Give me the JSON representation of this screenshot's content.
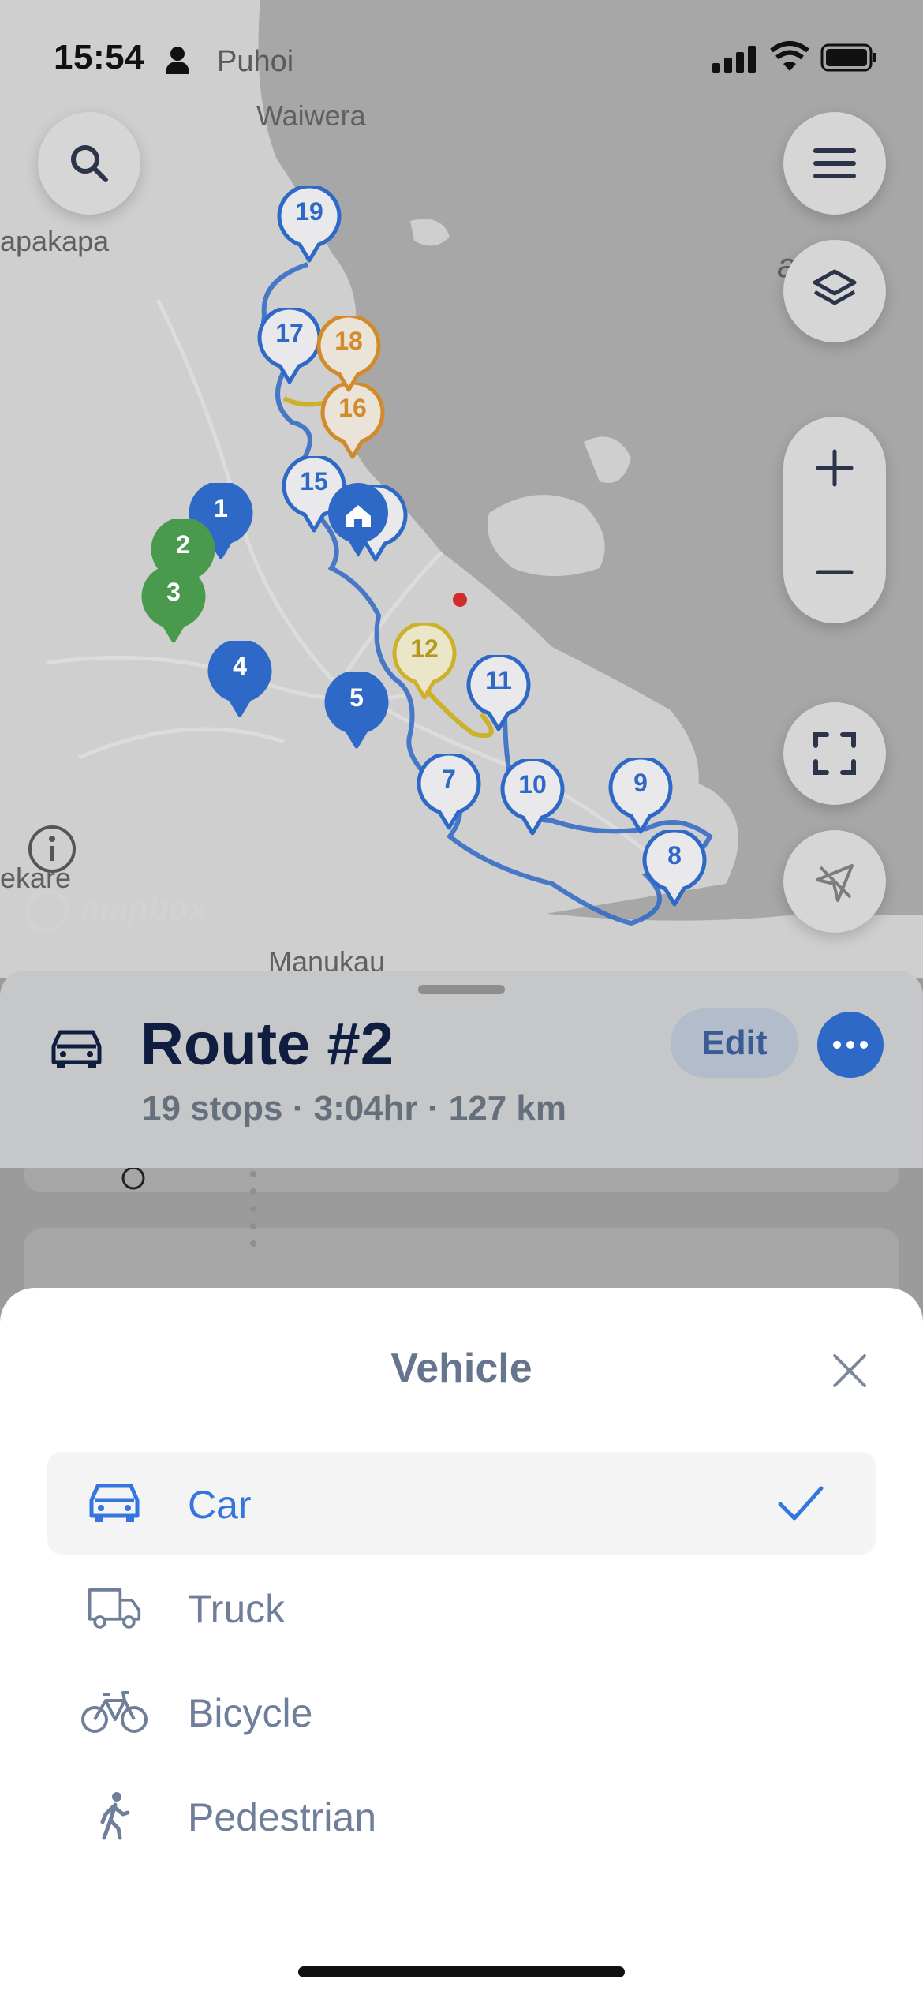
{
  "status_bar": {
    "time": "15:54",
    "location": "Puhoi"
  },
  "map": {
    "labels": [
      "Waiwera",
      "apakapa",
      "Manukau",
      "ekare"
    ],
    "partial_label": "a P",
    "stops": [
      {
        "num": "1",
        "color": "blue-solid"
      },
      {
        "num": "2",
        "color": "green"
      },
      {
        "num": "3",
        "color": "green"
      },
      {
        "num": "4",
        "color": "blue-solid"
      },
      {
        "num": "5",
        "color": "blue-solid"
      },
      {
        "num": "7",
        "color": "blue-outline"
      },
      {
        "num": "8",
        "color": "blue-outline"
      },
      {
        "num": "9",
        "color": "blue-outline"
      },
      {
        "num": "10",
        "color": "blue-outline"
      },
      {
        "num": "11",
        "color": "blue-outline"
      },
      {
        "num": "12",
        "color": "yellow-outline"
      },
      {
        "num": "15",
        "color": "blue-outline"
      },
      {
        "num": "16",
        "color": "orange-outline"
      },
      {
        "num": "17",
        "color": "blue-outline"
      },
      {
        "num": "18",
        "color": "orange-outline"
      },
      {
        "num": "19",
        "color": "blue-outline"
      },
      {
        "num": "1",
        "color": "blue-outline"
      }
    ],
    "attribution": "mapbox"
  },
  "route": {
    "title": "Route #2",
    "summary": "19 stops · 3:04hr · 127 km",
    "edit_label": "Edit"
  },
  "vehicle_sheet": {
    "title": "Vehicle",
    "options": [
      {
        "label": "Car",
        "icon": "car-icon",
        "selected": true
      },
      {
        "label": "Truck",
        "icon": "truck-icon",
        "selected": false
      },
      {
        "label": "Bicycle",
        "icon": "bicycle-icon",
        "selected": false
      },
      {
        "label": "Pedestrian",
        "icon": "pedestrian-icon",
        "selected": false
      }
    ]
  },
  "colors": {
    "accent": "#3476dd",
    "route_line": "#2f69c7",
    "stop_green": "#4a9a4e",
    "stop_orange": "#d28a2a",
    "stop_yellow": "#cdb12a",
    "title_dark": "#0f1e40"
  }
}
